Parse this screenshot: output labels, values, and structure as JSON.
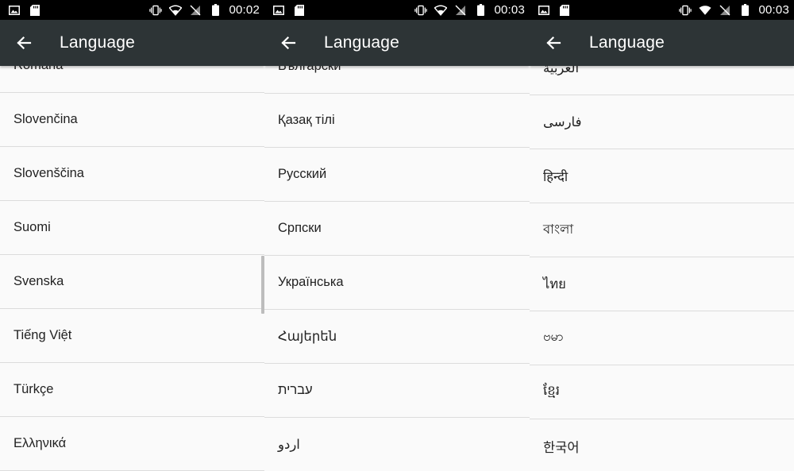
{
  "screens": [
    {
      "time": "00:02",
      "title": "Language",
      "items": [
        "Română",
        "Slovenčina",
        "Slovenščina",
        "Suomi",
        "Svenska",
        "Tiếng Việt",
        "Türkçe",
        "Ελληνικά"
      ]
    },
    {
      "time": "00:03",
      "title": "Language",
      "items": [
        "Български",
        "Қазақ тілі",
        "Русский",
        "Српски",
        "Українська",
        "Հայերեն",
        "עברית",
        "اردو"
      ]
    },
    {
      "time": "00:03",
      "title": "Language",
      "items": [
        "العربية",
        "فارسی",
        "हिन्दी",
        "বাংলা",
        "ไทย",
        "ဗမာ",
        "ខ្មែរ",
        "한국어"
      ]
    }
  ],
  "icons": {
    "status_left": [
      "image-icon",
      "sd-card-icon"
    ],
    "status_right": [
      "vibrate-icon",
      "wifi-icon",
      "no-sim-icon",
      "battery-icon"
    ],
    "appbar": "back-arrow-icon"
  },
  "colors": {
    "statusbar": "#000000",
    "appbar": "#2d3436",
    "list_bg": "#fafafa",
    "divider": "#dcdcdc"
  }
}
